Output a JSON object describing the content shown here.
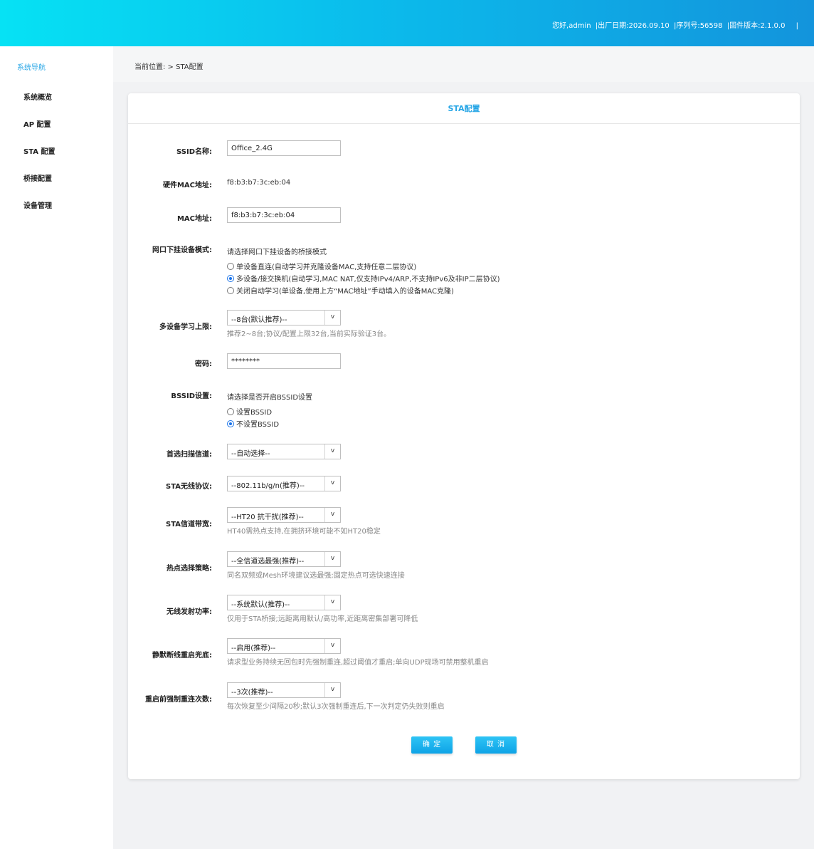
{
  "header": {
    "greeting": "您好,admin",
    "manufacture_date": "|出厂日期:2026.09.10",
    "serial": "|序列号:56598",
    "firmware": "|固件版本:2.1.0.0",
    "trailing_sep": "|"
  },
  "sidebar": {
    "title": "系统导航",
    "items": [
      "系统概览",
      "AP 配置",
      "STA 配置",
      "桥接配置",
      "设备管理"
    ]
  },
  "breadcrumb": {
    "text": "当前位置: > STA配置"
  },
  "panel": {
    "title": "STA配置",
    "ssid": {
      "label": "SSID名称:",
      "value": "Office_2.4G"
    },
    "hw_mac": {
      "label": "硬件MAC地址:",
      "value": "f8:b3:b7:3c:eb:04"
    },
    "mac": {
      "label": "MAC地址:",
      "value": "f8:b3:b7:3c:eb:04"
    },
    "port_mode": {
      "label": "网口下挂设备模式:",
      "desc": "请选择网口下挂设备的桥接模式",
      "options": [
        "单设备直连(自动学习并克隆设备MAC,支持任意二层协议)",
        "多设备/接交换机(自动学习,MAC NAT,仅支持IPv4/ARP,不支持IPv6及非IP二层协议)",
        "关闭自动学习(单设备,使用上方“MAC地址”手动填入的设备MAC克隆)"
      ],
      "selected": 1
    },
    "learn_limit": {
      "label": "多设备学习上限:",
      "value": "--8台(默认推荐)--",
      "hint": "推荐2~8台;协议/配置上限32台,当前实际验证3台。"
    },
    "password": {
      "label": "密码:",
      "value": "********"
    },
    "bssid": {
      "label": "BSSID设置:",
      "desc": "请选择是否开启BSSID设置",
      "options": [
        "设置BSSID",
        "不设置BSSID"
      ],
      "selected": 1
    },
    "scan_channel": {
      "label": "首选扫描信道:",
      "value": "--自动选择--"
    },
    "sta_protocol": {
      "label": "STA无线协议:",
      "value": "--802.11b/g/n(推荐)--"
    },
    "bandwidth": {
      "label": "STA信道带宽:",
      "value": "--HT20 抗干扰(推荐)--",
      "hint": "HT40需热点支持,在拥挤环境可能不如HT20稳定"
    },
    "hotspot_policy": {
      "label": "热点选择策略:",
      "value": "--全信道选最强(推荐)--",
      "hint": "同名双频或Mesh环境建议选最强;固定热点可选快速连接"
    },
    "tx_power": {
      "label": "无线发射功率:",
      "value": "--系统默认(推荐)--",
      "hint": "仅用于STA桥接;远距离用默认/高功率,近距离密集部署可降低"
    },
    "silent_restart": {
      "label": "静默断线重启兜底:",
      "value": "--启用(推荐)--",
      "hint": "请求型业务持续无回包时先强制重连,超过阈值才重启;单向UDP现场可禁用整机重启"
    },
    "reconnect_count": {
      "label": "重启前强制重连次数:",
      "value": "--3次(推荐)--",
      "hint": "每次恢复至少间隔20秒;默认3次强制重连后,下一次判定仍失败则重启"
    },
    "arrow": "v",
    "ok_label": "确 定",
    "cancel_label": "取 消"
  },
  "colors": {
    "accent": "#27a6e6",
    "header_start": "#06e2f4",
    "header_end": "#1394dc",
    "radio_checked": "#1a73e8"
  }
}
